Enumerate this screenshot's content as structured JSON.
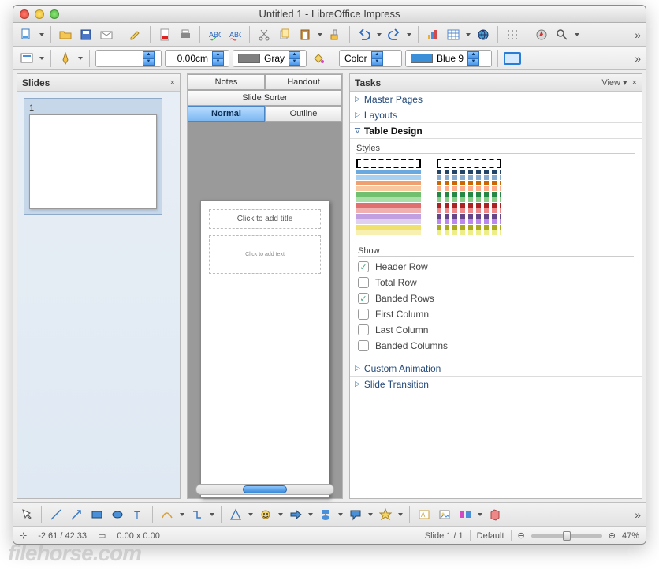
{
  "window": {
    "title": "Untitled 1 - LibreOffice Impress"
  },
  "toolbar2": {
    "line_width": "0.00cm",
    "area_color_label": "Gray",
    "area_color": "#808080",
    "color_label": "Color",
    "line_color_label": "Blue 9",
    "line_color": "#3b8fd8"
  },
  "panels": {
    "slides": {
      "title": "Slides",
      "slide_number": "1"
    },
    "tasks": {
      "title": "Tasks",
      "view_label": "View"
    }
  },
  "tabs": {
    "notes": "Notes",
    "handout": "Handout",
    "sorter": "Slide Sorter",
    "normal": "Normal",
    "outline": "Outline"
  },
  "canvas": {
    "title_placeholder": "Click to add title",
    "body_placeholder": "Click to add text"
  },
  "task_sections": {
    "master": "Master Pages",
    "layouts": "Layouts",
    "table": "Table Design",
    "custom": "Custom Animation",
    "transition": "Slide Transition"
  },
  "table_design": {
    "styles_label": "Styles",
    "show_label": "Show",
    "opts": {
      "header": "Header Row",
      "total": "Total Row",
      "banded_rows": "Banded Rows",
      "first_col": "First Column",
      "last_col": "Last Column",
      "banded_cols": "Banded Columns"
    },
    "checked": {
      "header": true,
      "total": false,
      "banded_rows": true,
      "first_col": false,
      "last_col": false,
      "banded_cols": false
    }
  },
  "status": {
    "coords": "-2.61 / 42.33",
    "size": "0.00 x 0.00",
    "slide": "Slide 1 / 1",
    "layout": "Default",
    "zoom": "47%"
  },
  "watermark": "filehorse.com"
}
